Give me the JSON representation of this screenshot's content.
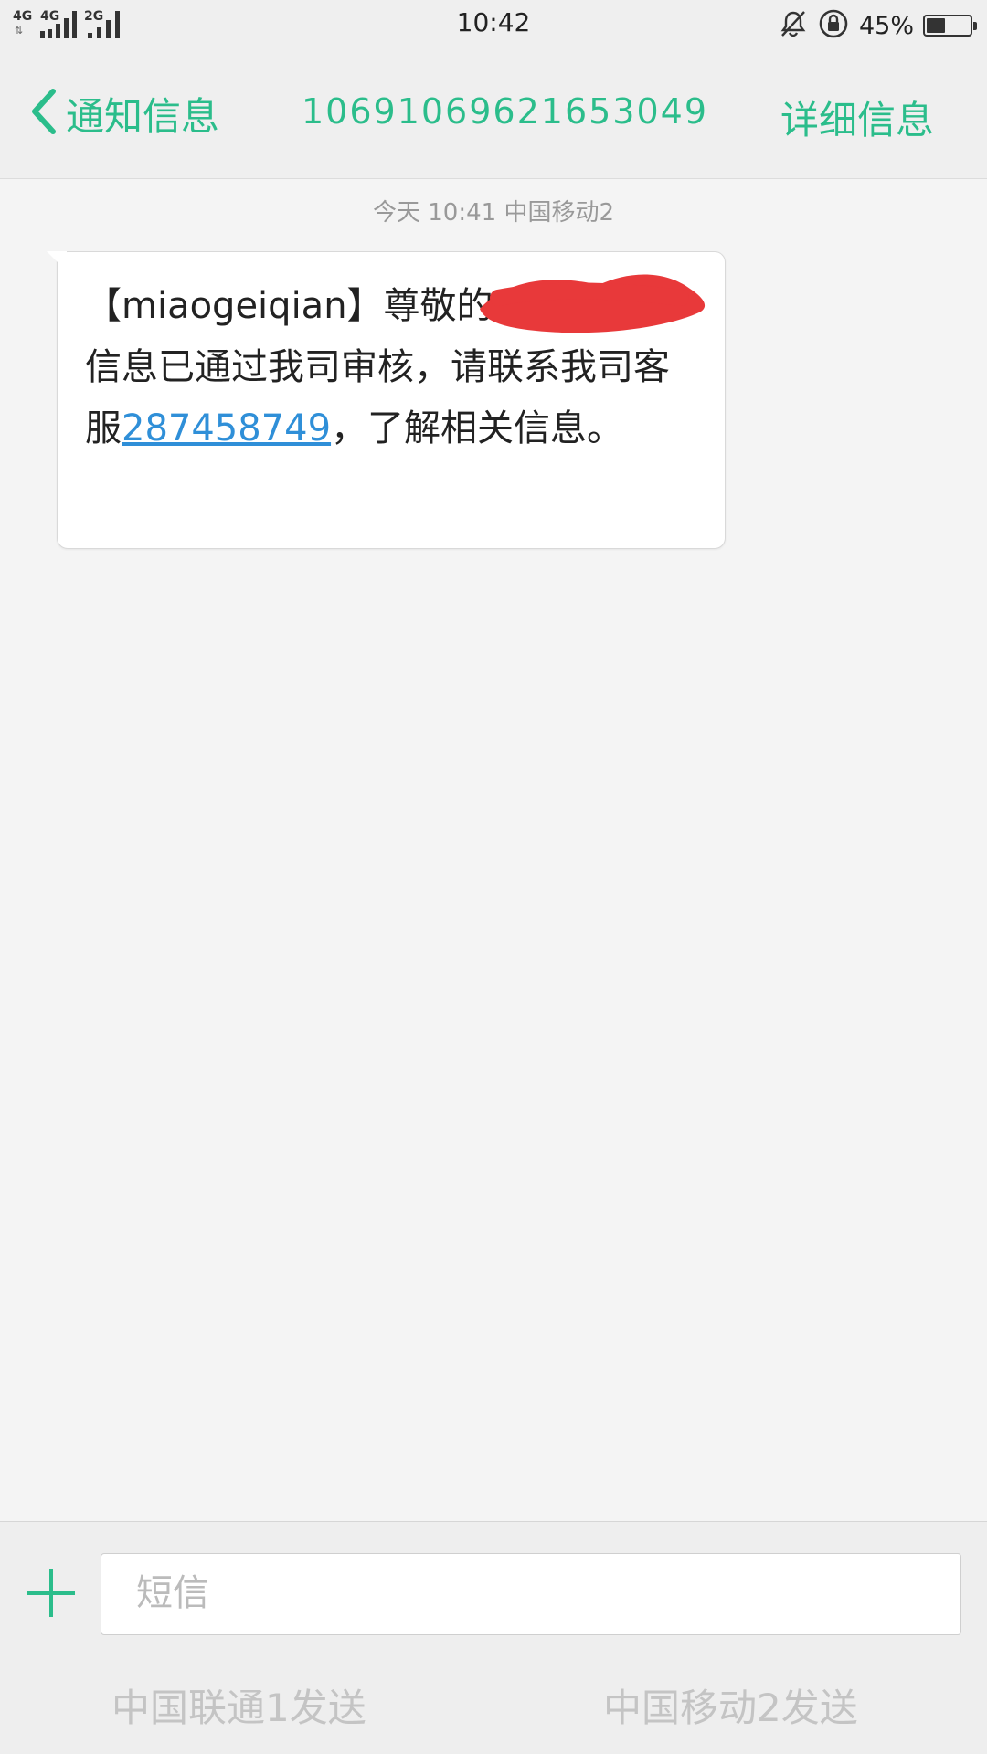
{
  "status_bar": {
    "sim1_network": "4G",
    "sim1_network_2": "4G",
    "sim2_network": "2G",
    "time": "10:42",
    "battery_percent_text": "45%",
    "battery_level": 0.45,
    "icons": [
      "signal-icon",
      "bell-muted-icon",
      "rotation-lock-icon",
      "battery-icon"
    ]
  },
  "header": {
    "back_label": "通知信息",
    "sender_number": "10691069621653049",
    "detail_label": "详细信息"
  },
  "conversation": {
    "timestamp": "今天 10:41   中国移动2",
    "message": {
      "part1": "【miaogeiqian】尊敬的",
      "part2": "，您提交的信息已通过我司审核，请联系我司客服",
      "link": "287458749",
      "part3": "，了解相关信息。"
    }
  },
  "composer": {
    "placeholder": "短信",
    "send_sim1": "中国联通1发送",
    "send_sim2": "中国移动2发送"
  },
  "colors": {
    "accent": "#2bbd8b",
    "link": "#2f8fd8",
    "redaction": "#e8393a"
  }
}
